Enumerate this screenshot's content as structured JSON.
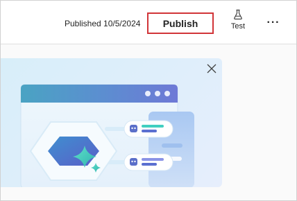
{
  "header": {
    "published_text": "Published 10/5/2024",
    "publish_label": "Publish",
    "test_label": "Test",
    "more_label": "···"
  },
  "icons": {
    "test": "flask-icon",
    "more": "more-horizontal-icon",
    "close": "close-icon"
  },
  "colors": {
    "publish_highlight": "#d13438",
    "banner_background": "#dcedfa",
    "window_header": "#4a9fbf",
    "hexagon": "#4f6bc9",
    "sparkle": "#3cc6b8"
  }
}
